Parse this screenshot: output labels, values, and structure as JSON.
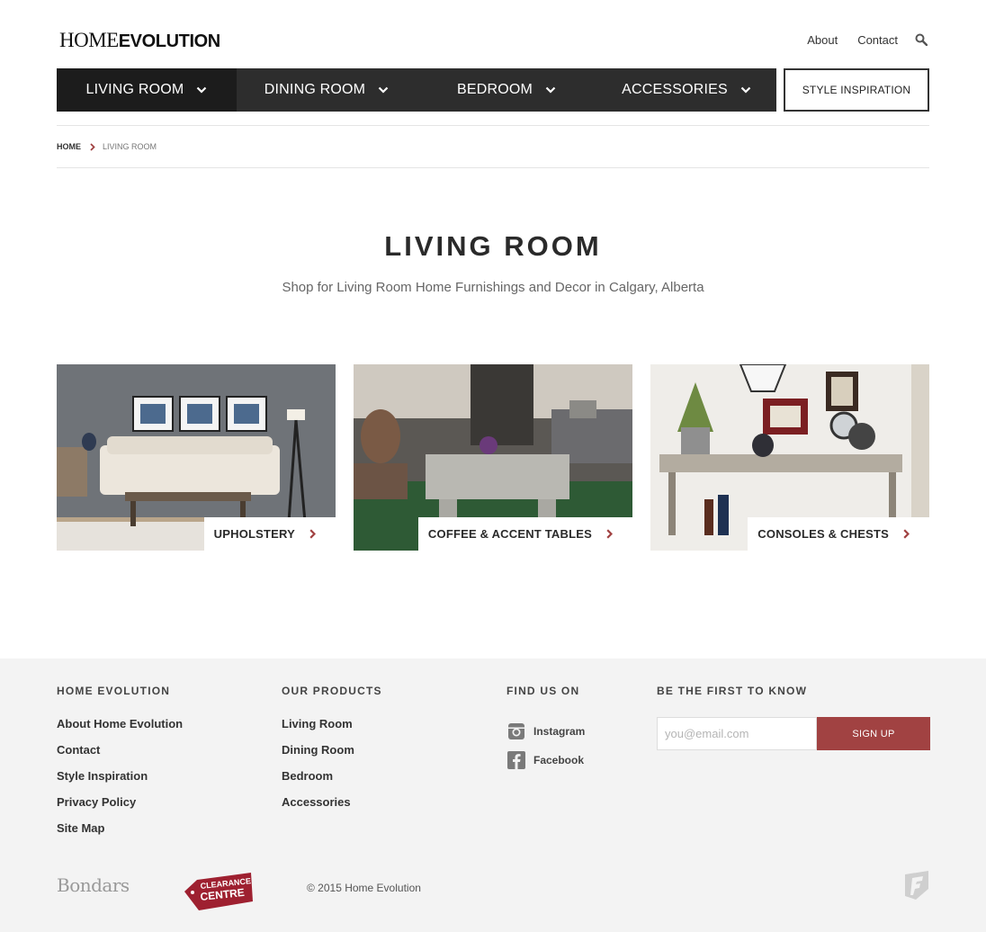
{
  "header": {
    "logo_home": "HOME",
    "logo_evolution": "EVOLUTION",
    "links": [
      "About",
      "Contact"
    ],
    "search_icon": "search-icon"
  },
  "nav": {
    "items": [
      {
        "label": "LIVING ROOM",
        "active": true
      },
      {
        "label": "DINING ROOM",
        "active": false
      },
      {
        "label": "BEDROOM",
        "active": false
      },
      {
        "label": "ACCESSORIES",
        "active": false
      }
    ],
    "style_inspiration": "STYLE INSPIRATION"
  },
  "breadcrumb": {
    "home": "HOME",
    "current": "LIVING ROOM"
  },
  "page": {
    "title": "LIVING ROOM",
    "subtitle": "Shop for Living Room Home Furnishings and Decor in Calgary, Alberta"
  },
  "categories": [
    {
      "label": "UPHOLSTERY"
    },
    {
      "label": "COFFEE & ACCENT TABLES"
    },
    {
      "label": "CONSOLES & CHESTS"
    }
  ],
  "footer": {
    "col1": {
      "heading": "HOME EVOLUTION",
      "links": [
        "About Home Evolution",
        "Contact",
        "Style Inspiration",
        "Privacy Policy",
        "Site Map"
      ]
    },
    "col2": {
      "heading": "OUR PRODUCTS",
      "links": [
        "Living Room",
        "Dining Room",
        "Bedroom",
        "Accessories"
      ]
    },
    "col3": {
      "heading": "FIND US ON",
      "social": [
        "Instagram",
        "Facebook"
      ]
    },
    "col4": {
      "heading": "BE THE FIRST TO KNOW",
      "email_placeholder": "you@email.com",
      "signup_label": "SIGN UP"
    },
    "bondars": "Bondars",
    "clearance_line1": "CLEARANCE",
    "clearance_line2": "CENTRE",
    "copyright": "© 2015 Home Evolution"
  },
  "colors": {
    "nav_bg": "#2d2d2d",
    "nav_active_bg": "#1c1c1c",
    "accent": "#a14242",
    "footer_bg": "#f3f3f3"
  }
}
